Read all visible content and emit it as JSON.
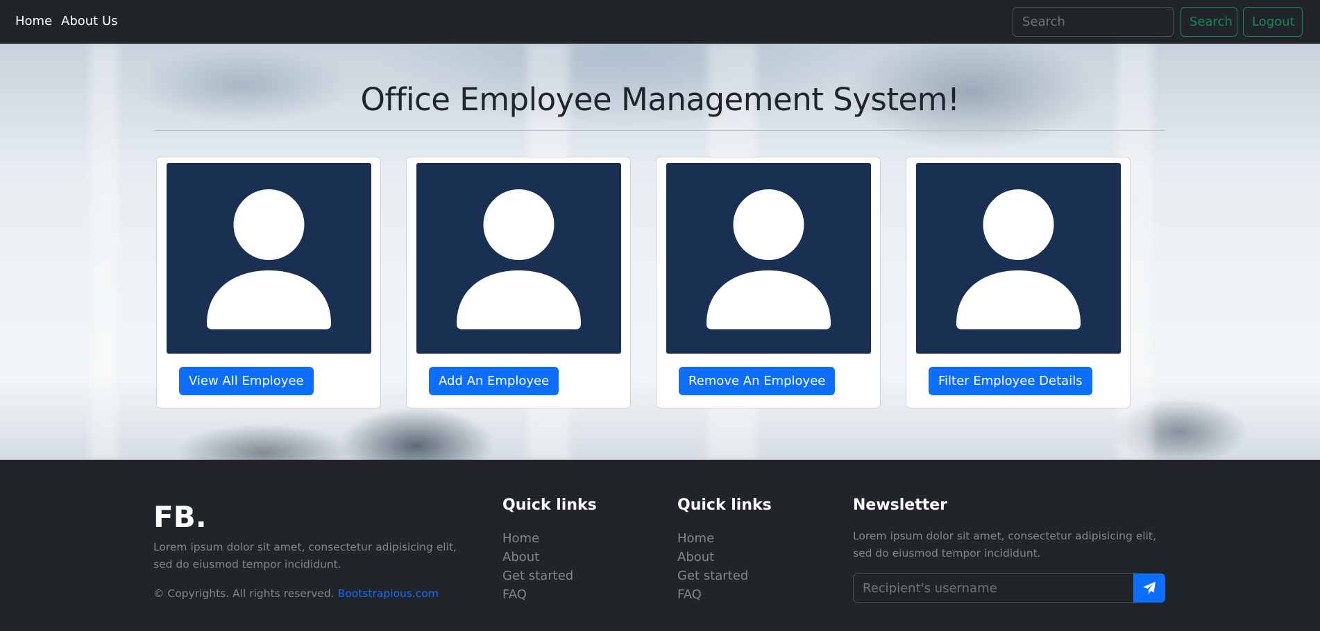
{
  "navbar": {
    "links": [
      "Home",
      "About Us"
    ],
    "search_placeholder": "Search",
    "search_button": "Search",
    "logout_button": "Logout",
    "accent_color": "#198754"
  },
  "hero": {
    "title": "Office Employee Management System!",
    "cards": [
      {
        "icon": "user-avatar-icon",
        "button": "View All Employee"
      },
      {
        "icon": "user-avatar-icon",
        "button": "Add An Employee"
      },
      {
        "icon": "user-avatar-icon",
        "button": "Remove An Employee"
      },
      {
        "icon": "user-avatar-icon",
        "button": "Filter Employee Details"
      }
    ],
    "button_color": "#0d6efd",
    "avatar_bg_color": "#1a3052"
  },
  "footer": {
    "brand": "FB.",
    "brand_text": "Lorem ipsum dolor sit amet, consectetur adipisicing elit, sed do eiusmod tempor incididunt.",
    "copyright_text": "© Copyrights. All rights reserved.",
    "copyright_link": "Bootstrapious.com",
    "columns": [
      {
        "heading": "Quick links",
        "links": [
          "Home",
          "About",
          "Get started",
          "FAQ"
        ]
      },
      {
        "heading": "Quick links",
        "links": [
          "Home",
          "About",
          "Get started",
          "FAQ"
        ]
      }
    ],
    "newsletter": {
      "heading": "Newsletter",
      "text": "Lorem ipsum dolor sit amet, consectetur adipisicing elit, sed do eiusmod tempor incididunt.",
      "input_placeholder": "Recipient's username",
      "send_icon": "paper-plane-icon"
    }
  }
}
